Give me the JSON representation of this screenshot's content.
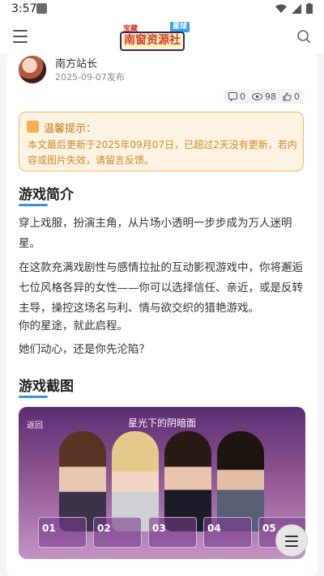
{
  "status_bar": {
    "time": "3:57"
  },
  "header": {
    "logo_top": "宝藏",
    "logo_main": "南窗资源社",
    "logo_tag": "星球"
  },
  "post": {
    "author": "南方站长",
    "date": "2025-09-07发布",
    "stats": {
      "comments": "0",
      "views": "98",
      "likes": "0"
    }
  },
  "notice": {
    "title": "温馨提示：",
    "body": "本文最后更新于2025年09月07日，已超过2天没有更新，若内容或图片失效，请留言反馈。"
  },
  "intro": {
    "heading": "游戏简介",
    "paragraphs": [
      "穿上戏服，扮演主角，从片场小透明一步步成为万人迷明星。",
      "在这款充满戏剧性与感情拉扯的互动影视游戏中，你将邂逅七位风格各异的女性——你可以选择信任、亲近，或是反转主导，操控这场名与利、情与欲交织的猎艳游戏。",
      "你的星途，就此启程。",
      "她们动心，还是你先沦陷？"
    ]
  },
  "screenshots": {
    "heading": "游戏截图",
    "image_title": "星光下的阴暗面",
    "back_label": "返回",
    "thumbs": [
      "01",
      "02",
      "03",
      "04",
      "05"
    ]
  },
  "colors": {
    "accent": "#3b8fe6",
    "notice_border": "#f1b56a",
    "notice_text": "#d08c2c"
  }
}
